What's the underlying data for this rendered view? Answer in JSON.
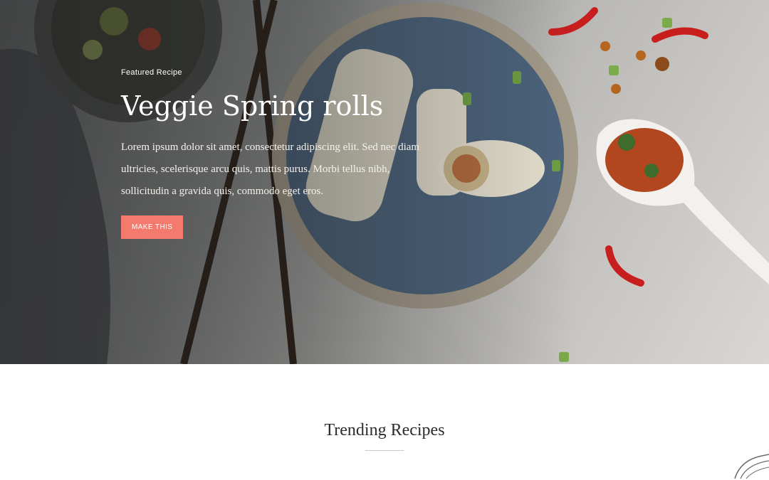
{
  "hero": {
    "eyebrow": "Featured Recipe",
    "title": "Veggie Spring rolls",
    "description": "Lorem ipsum dolor sit amet, consectetur adipiscing elit. Sed nec diam ultricies, scelerisque arcu quis, mattis purus. Morbi tellus nibh, sollicitudin a gravida quis, commodo eget eros.",
    "cta_label": "MAKE THIS"
  },
  "trending": {
    "title": "Trending Recipes"
  },
  "colors": {
    "accent": "#f47a6d",
    "heading": "#2b2b2b"
  }
}
